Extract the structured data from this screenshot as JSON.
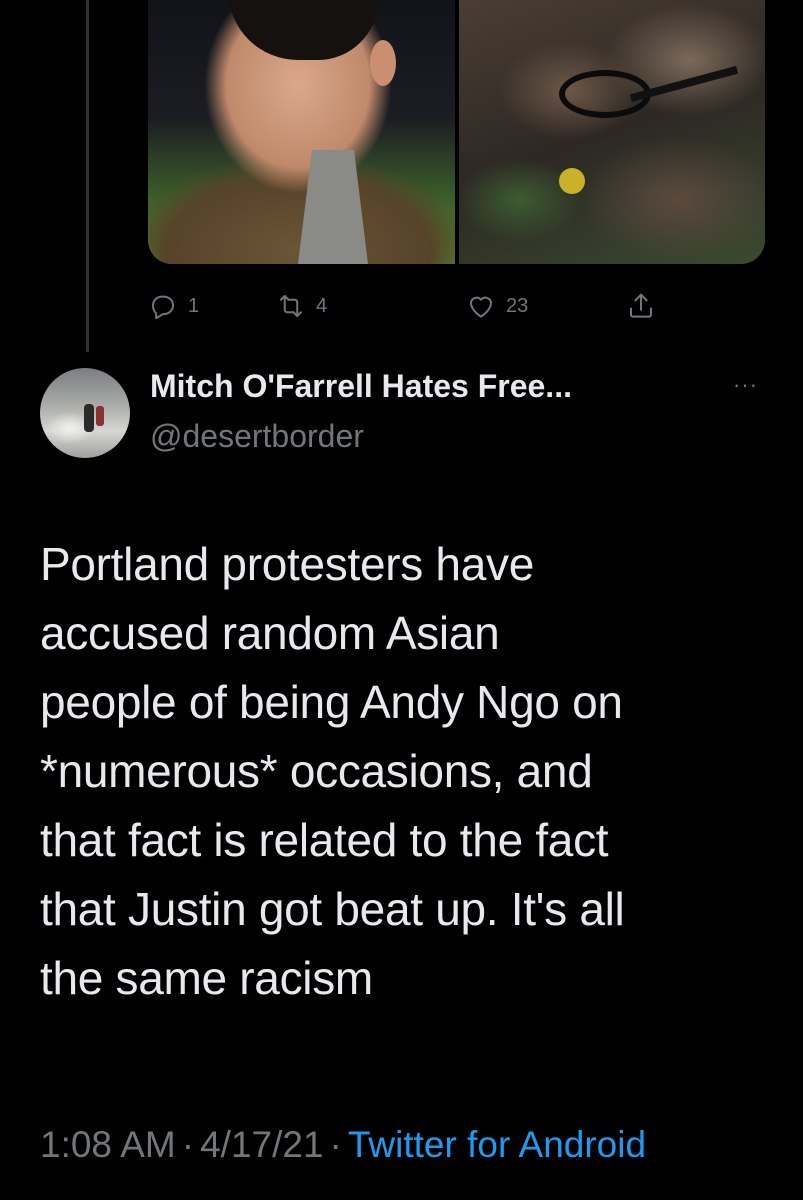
{
  "tweet_above": {
    "stats": {
      "replies": "1",
      "retweets": "4",
      "likes": "23"
    }
  },
  "tweet": {
    "display_name": "Mitch O'Farrell Hates Free...",
    "handle": "@desertborder",
    "more_label": "···",
    "text": "Portland protesters have\naccused random Asian\npeople of being Andy Ngo on\n*numerous* occasions, and\nthat fact is related to the fact\nthat Justin got beat up. It's all\nthe same racism",
    "time": "1:08 AM",
    "date": "4/17/21",
    "separator": "·",
    "source": "Twitter for Android"
  },
  "colors": {
    "background": "#000000",
    "text": "#e7e9ea",
    "muted": "#71767b",
    "link": "#1d9bf0"
  }
}
